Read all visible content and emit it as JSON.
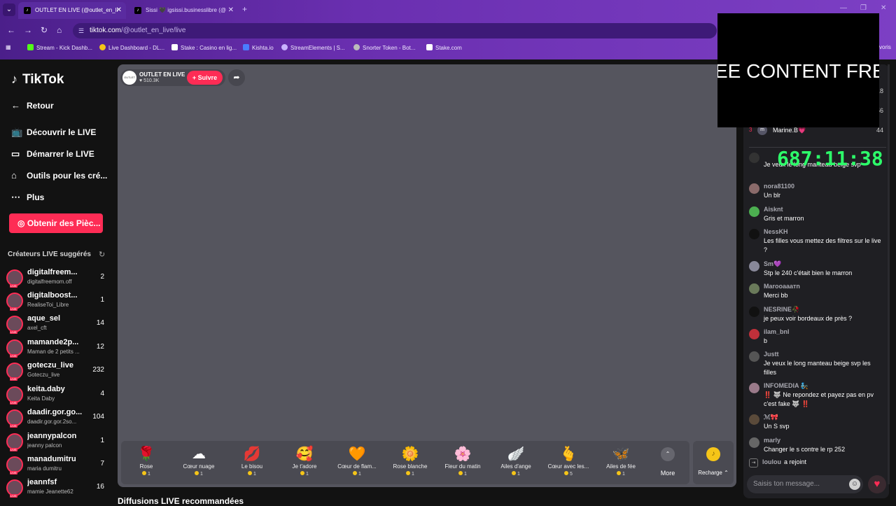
{
  "browser": {
    "tabs": [
      {
        "label": "OUTLET EN LIVE (@outlet_en_li",
        "active": true
      },
      {
        "label": "Sissi 🖤 igsissi.businesslibre (@",
        "active": false
      }
    ],
    "url_host": "tiktok.com",
    "url_path": "/@outlet_en_live/live",
    "bookmarks": [
      {
        "label": "Stream - Kick Dashb...",
        "color": "#53fc18"
      },
      {
        "label": "Live Dashboard - DL...",
        "color": "#f5c518"
      },
      {
        "label": "Stake : Casino en lig...",
        "color": "#ffffff"
      },
      {
        "label": "Kishta.io",
        "color": "#4a7dff"
      },
      {
        "label": "StreamElements | S...",
        "color": "#c9b3ff"
      },
      {
        "label": "Snorter Token - Bot...",
        "color": "#bbbbbb"
      },
      {
        "label": "Stake.com",
        "color": "#ffffff"
      }
    ],
    "bookmarks_right": "voris"
  },
  "overlay": {
    "banner_text": "EE CONTENT  FRE",
    "timer": "687:11:38"
  },
  "sidebar": {
    "logo": "TikTok",
    "back": "Retour",
    "nav": [
      {
        "label": "Découvrir le LIVE",
        "icon": "live-tv-icon"
      },
      {
        "label": "Démarrer le LIVE",
        "icon": "camera-icon"
      },
      {
        "label": "Outils pour les cré...",
        "icon": "home-icon"
      },
      {
        "label": "Plus",
        "icon": "more-dots-icon"
      }
    ],
    "coins_button": "Obtenir des Pièc...",
    "suggested_title": "Créateurs LIVE suggérés",
    "creators": [
      {
        "name": "digitalfreem...",
        "sub": "digitalfreemom.off",
        "count": "2"
      },
      {
        "name": "digitalboost...",
        "sub": "RealiseToi_Libre",
        "count": "1"
      },
      {
        "name": "aque_sel",
        "sub": "axel_cft",
        "count": "14"
      },
      {
        "name": "mamande2p...",
        "sub": "Maman de 2 petits ...",
        "count": "12"
      },
      {
        "name": "goteczu_live",
        "sub": "Goteczu_live",
        "count": "232"
      },
      {
        "name": "keita.daby",
        "sub": "Keita Daby",
        "count": "4"
      },
      {
        "name": "daadir.gor.go...",
        "sub": "daadir.gor.gor.2so...",
        "count": "104"
      },
      {
        "name": "jeannypalcon",
        "sub": "jeanny palcon",
        "count": "1"
      },
      {
        "name": "manadumitru",
        "sub": "maria dumitru",
        "count": "7"
      },
      {
        "name": "jeannfsf",
        "sub": "mamie Jeanette62",
        "count": "16"
      }
    ]
  },
  "stream": {
    "host_name": "OUTLET EN LIVE",
    "host_avatar_text": "OUTLET",
    "likes": "510.3K",
    "follow": "+ Suivre",
    "gifts": [
      {
        "icon": "🌹",
        "name": "Rose",
        "price": "1"
      },
      {
        "icon": "☁",
        "name": "Cœur nuage",
        "price": "1"
      },
      {
        "icon": "💋",
        "name": "Le bisou",
        "price": "1"
      },
      {
        "icon": "🥰",
        "name": "Je t'adore",
        "price": "1"
      },
      {
        "icon": "🧡",
        "name": "Cœur de flam...",
        "price": "1"
      },
      {
        "icon": "🌼",
        "name": "Rose blanche",
        "price": "1"
      },
      {
        "icon": "🌸",
        "name": "Fleur du matin",
        "price": "1"
      },
      {
        "icon": "🪽",
        "name": "Ailes d'ange",
        "price": "1"
      },
      {
        "icon": "🫰",
        "name": "Cœur avec les...",
        "price": "5"
      },
      {
        "icon": "🦋",
        "name": "Ailes de fée",
        "price": "1"
      }
    ],
    "more": "More",
    "recharge": "Recharge",
    "recommended_title": "Diffusions LIVE recommandées"
  },
  "chat": {
    "ranking": [
      {
        "rank": "",
        "name": "",
        "value": "18"
      },
      {
        "rank": "",
        "name": "",
        "value": "56"
      },
      {
        "rank": "3",
        "name": "Marine.B💗",
        "avatar": "m",
        "value": "44"
      }
    ],
    "messages": [
      {
        "user": "",
        "text": "Je veux le long manteau beige svp",
        "avatar_color": "#333333"
      },
      {
        "user": "nora81100",
        "text": "Un blr",
        "avatar_color": "#8a6a6a"
      },
      {
        "user": "Aisknt",
        "text": "Gris et marron",
        "avatar_color": "#4caf50"
      },
      {
        "user": "NessKH",
        "text": "Les filles vous mettez des filtres sur le live ?",
        "avatar_color": "#111111"
      },
      {
        "user": "Sm💜",
        "text": "Stp le 240 c'était bien le marron",
        "avatar_color": "#888899"
      },
      {
        "user": "Marooaaaтn",
        "text": "Merci bb",
        "avatar_color": "#6a7a5a"
      },
      {
        "user": "NESRINE🥀",
        "text": "je peux voir bordeaux de près ?",
        "avatar_color": "#111111"
      },
      {
        "user": "ilam_bnl",
        "text": "b",
        "avatar_color": "#c0303a"
      },
      {
        "user": "Justt",
        "text": "Je veux le long manteau beige svp les filles",
        "avatar_color": "#555555"
      },
      {
        "user": "INFOMEDIA 🧞",
        "text": "‼️ 🐺 Ne repondez et payez pas en pv c'est fake 🐺 ‼️",
        "avatar_color": "#9a7a8a"
      },
      {
        "user": "ℳ🎀",
        "text": "Un S svp",
        "avatar_color": "#5a4a3a"
      },
      {
        "user": "marly",
        "text": "Changer le s contre le rp 252",
        "avatar_color": "#666666"
      }
    ],
    "joined_user": "loulou",
    "joined_text": "a rejoint",
    "input_placeholder": "Saisis ton message..."
  }
}
